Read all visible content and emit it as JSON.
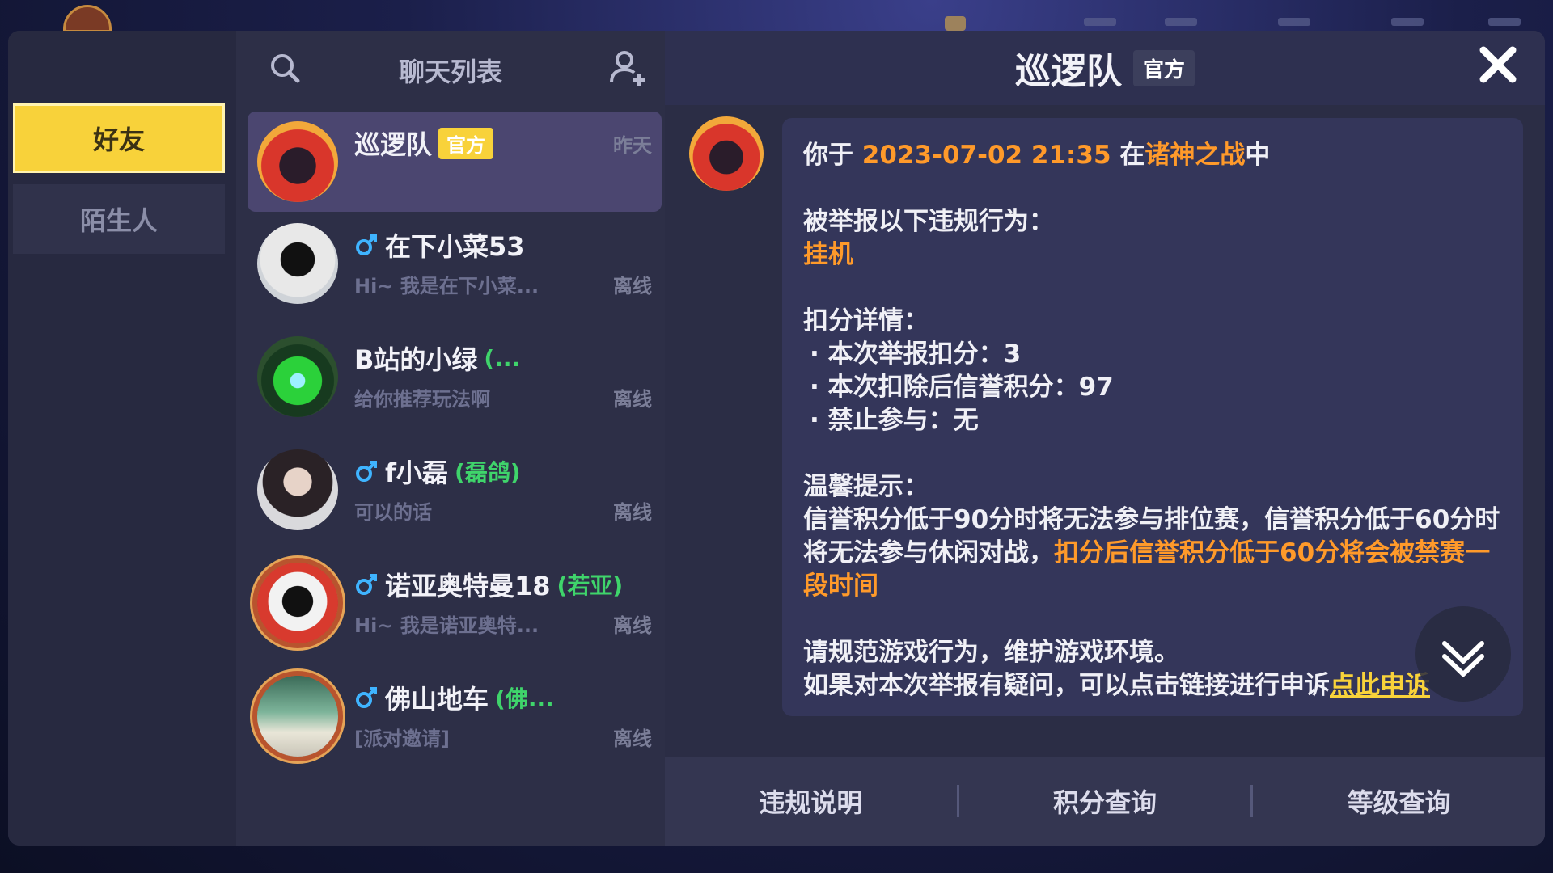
{
  "sidebar": {
    "tabs": [
      {
        "label": "好友",
        "active": true
      },
      {
        "label": "陌生人",
        "active": false
      }
    ]
  },
  "chat_list": {
    "title": "聊天列表",
    "items": [
      {
        "name": "巡逻队",
        "badge": "官方",
        "time": "昨天",
        "active": true
      },
      {
        "name": "在下小菜53",
        "remark": "",
        "preview": "Hi~ 我是在下小菜...",
        "status": "离线",
        "male": true
      },
      {
        "name": "B站的小绿",
        "remark": "(...",
        "preview": "给你推荐玩法啊",
        "status": "离线",
        "male": false
      },
      {
        "name": "f小磊",
        "remark": "(磊鸽)",
        "preview": "可以的话",
        "status": "离线",
        "male": true
      },
      {
        "name": "诺亚奥特曼18",
        "remark": "(若亚)",
        "preview": "Hi~ 我是诺亚奥特...",
        "status": "离线",
        "male": true
      },
      {
        "name": "佛山地车",
        "remark": "(佛...",
        "preview": "[派对邀请]",
        "status": "离线",
        "male": true
      }
    ]
  },
  "conversation": {
    "title": "巡逻队",
    "badge": "官方",
    "message": {
      "line1_pre": "你于 ",
      "datetime": "2023-07-02 21:35",
      "line1_mid": " 在",
      "mode": "诸神之战",
      "line1_post": "中",
      "report_head": "被举报以下违规行为：",
      "violation": "挂机",
      "deduct_head": "扣分详情：",
      "bullets": [
        "本次举报扣分：3",
        "本次扣除后信誉积分：97",
        "禁止参与：无"
      ],
      "tip_head": "温馨提示：",
      "tip_text_1": "信誉积分低于90分时将无法参与排位赛，信誉积分低于60分时将无法参与休闲对战，",
      "tip_text_2": "扣分后信誉积分低于60分将会被禁赛一段时间",
      "closing_1": "请规范游戏行为，维护游戏环境。",
      "closing_2": "如果对本次举报有疑问，可以点击链接进行申诉",
      "appeal_link": "点此申诉"
    },
    "footer_buttons": [
      "违规说明",
      "积分查询",
      "等级查询"
    ]
  },
  "colors": {
    "accent_yellow": "#f8d23a",
    "highlight_orange": "#ff9a2a",
    "remark_green": "#3fd46b"
  }
}
